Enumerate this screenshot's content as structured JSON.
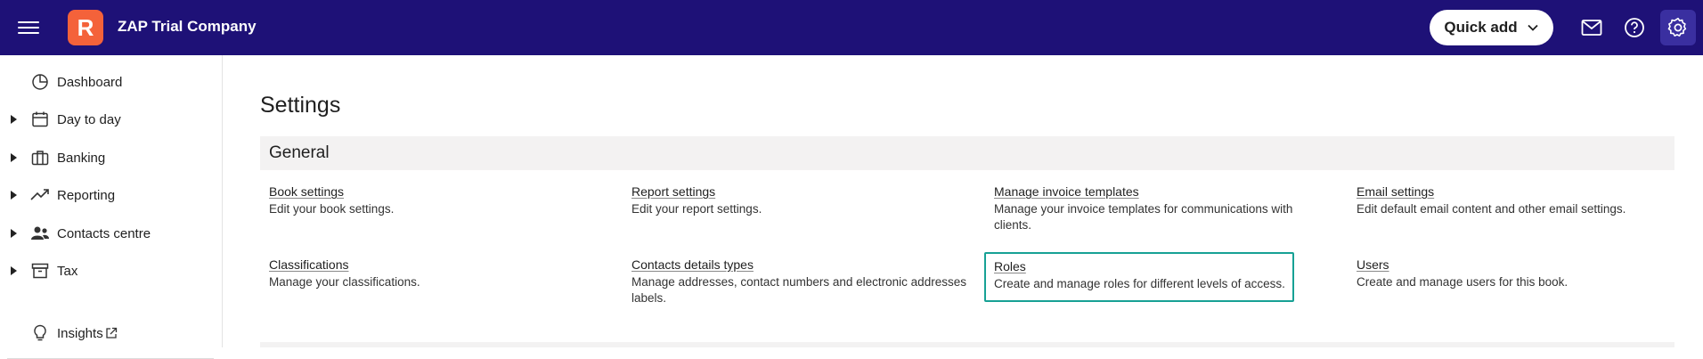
{
  "header": {
    "logo_letter": "R",
    "company_name": "ZAP Trial Company",
    "quick_add_label": "Quick add",
    "colors": {
      "bar": "#1e1177",
      "logo": "#f4623a",
      "settings_active": "#3a2fa0"
    },
    "icons": [
      "menu-icon",
      "mail-icon",
      "help-icon",
      "gear-icon"
    ]
  },
  "sidebar": {
    "items": [
      {
        "label": "Dashboard",
        "icon": "pie-chart-icon",
        "expandable": false
      },
      {
        "label": "Day to day",
        "icon": "calendar-icon",
        "expandable": true
      },
      {
        "label": "Banking",
        "icon": "briefcase-icon",
        "expandable": true
      },
      {
        "label": "Reporting",
        "icon": "trend-line-icon",
        "expandable": true
      },
      {
        "label": "Contacts centre",
        "icon": "people-icon",
        "expandable": true
      },
      {
        "label": "Tax",
        "icon": "archive-box-icon",
        "expandable": true
      }
    ],
    "insights_label": "Insights",
    "insights_icon": "lightbulb-icon"
  },
  "main": {
    "page_title": "Settings",
    "section_title": "General",
    "cards": [
      {
        "title": "Book settings",
        "description": "Edit your book settings."
      },
      {
        "title": "Report settings",
        "description": "Edit your report settings."
      },
      {
        "title": "Manage invoice templates",
        "description": "Manage your invoice templates for communications with clients."
      },
      {
        "title": "Email settings",
        "description": "Edit default email content and other email settings."
      },
      {
        "title": "Classifications",
        "description": "Manage your classifications."
      },
      {
        "title": "Contacts details types",
        "description": "Manage addresses, contact numbers and electronic addresses labels."
      },
      {
        "title": "Roles",
        "description": "Create and manage roles for different levels of access."
      },
      {
        "title": "Users",
        "description": "Create and manage users for this book."
      }
    ],
    "focus_color": "#17a195"
  }
}
